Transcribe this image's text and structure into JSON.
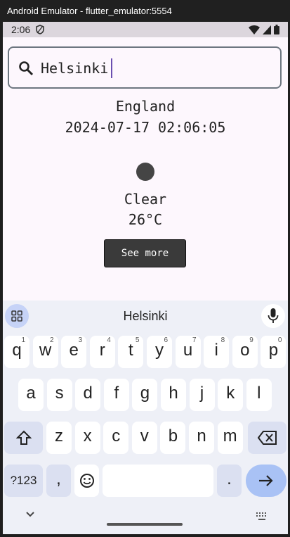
{
  "window": {
    "title": "Android Emulator - flutter_emulator:5554"
  },
  "status_bar": {
    "time": "2:06"
  },
  "search": {
    "value": "Helsinki",
    "icon": "search-icon"
  },
  "weather": {
    "location": "England",
    "datetime": "2024-07-17 02:06:05",
    "condition": "Clear",
    "temperature": "26°C",
    "icon_color": "#454545"
  },
  "see_more": {
    "label": "See more"
  },
  "keyboard": {
    "suggestion": "Helsinki",
    "row1": [
      {
        "k": "q",
        "h": "1"
      },
      {
        "k": "w",
        "h": "2"
      },
      {
        "k": "e",
        "h": "3"
      },
      {
        "k": "r",
        "h": "4"
      },
      {
        "k": "t",
        "h": "5"
      },
      {
        "k": "y",
        "h": "6"
      },
      {
        "k": "u",
        "h": "7"
      },
      {
        "k": "i",
        "h": "8"
      },
      {
        "k": "o",
        "h": "9"
      },
      {
        "k": "p",
        "h": "0"
      }
    ],
    "row2": [
      "a",
      "s",
      "d",
      "f",
      "g",
      "h",
      "j",
      "k",
      "l"
    ],
    "row3": [
      "z",
      "x",
      "c",
      "v",
      "b",
      "n",
      "m"
    ],
    "symbols_label": "?123",
    "comma": ",",
    "period": ".",
    "accent_color": "#a9c2f5"
  }
}
